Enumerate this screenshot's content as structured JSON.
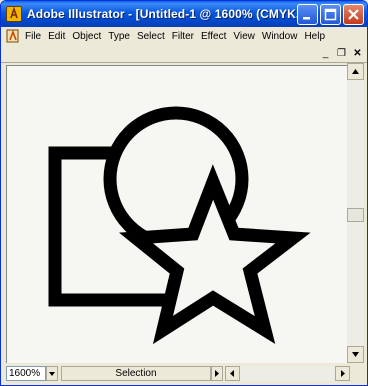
{
  "window": {
    "title": "Adobe Illustrator - [Untitled-1 @ 1600% (CMYK..."
  },
  "menu": [
    "File",
    "Edit",
    "Object",
    "Type",
    "Select",
    "Filter",
    "Effect",
    "View",
    "Window",
    "Help"
  ],
  "mdi_controls": {
    "minimize": "_",
    "restore": "❐",
    "close": "✕"
  },
  "artwork": {
    "shapes": [
      "rectangle",
      "circle",
      "star"
    ],
    "stroke_color": "#000000",
    "fill_color": "#f6f7f2"
  },
  "status": {
    "zoom": "1600%",
    "tool": "Selection"
  },
  "colors": {
    "title_bar": "#0858e0",
    "chrome": "#ece9d8",
    "canvas": "#f6f7f2"
  }
}
